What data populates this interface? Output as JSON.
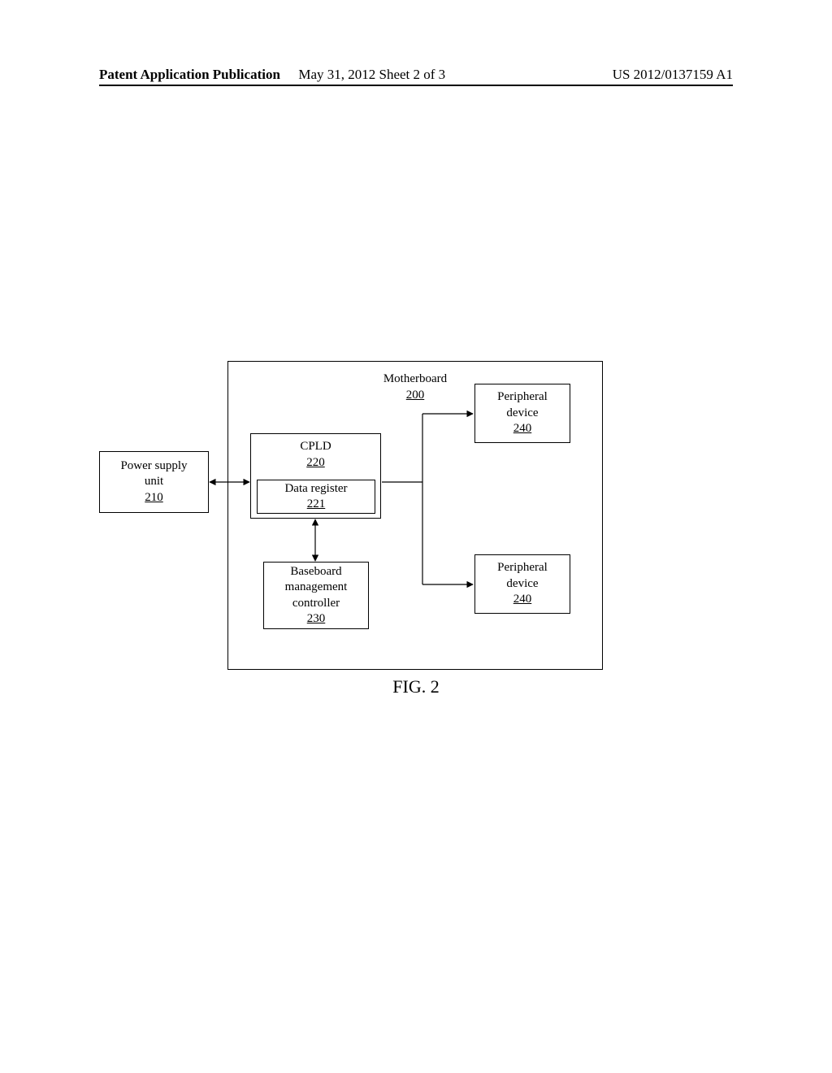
{
  "header": {
    "publication_type": "Patent Application Publication",
    "date_sheet": "May 31, 2012  Sheet 2 of 3",
    "pub_number": "US 2012/0137159 A1"
  },
  "figure_caption": "FIG. 2",
  "blocks": {
    "motherboard": {
      "label": "Motherboard",
      "ref": "200"
    },
    "psu": {
      "label1": "Power supply",
      "label2": "unit",
      "ref": "210"
    },
    "cpld": {
      "label": "CPLD",
      "ref": "220"
    },
    "dreg": {
      "label": "Data register",
      "ref": "221"
    },
    "bmc": {
      "label1": "Baseboard",
      "label2": "management",
      "label3": "controller",
      "ref": "230"
    },
    "pd1": {
      "label1": "Peripheral",
      "label2": "device",
      "ref": "240"
    },
    "pd2": {
      "label1": "Peripheral",
      "label2": "device",
      "ref": "240"
    }
  }
}
